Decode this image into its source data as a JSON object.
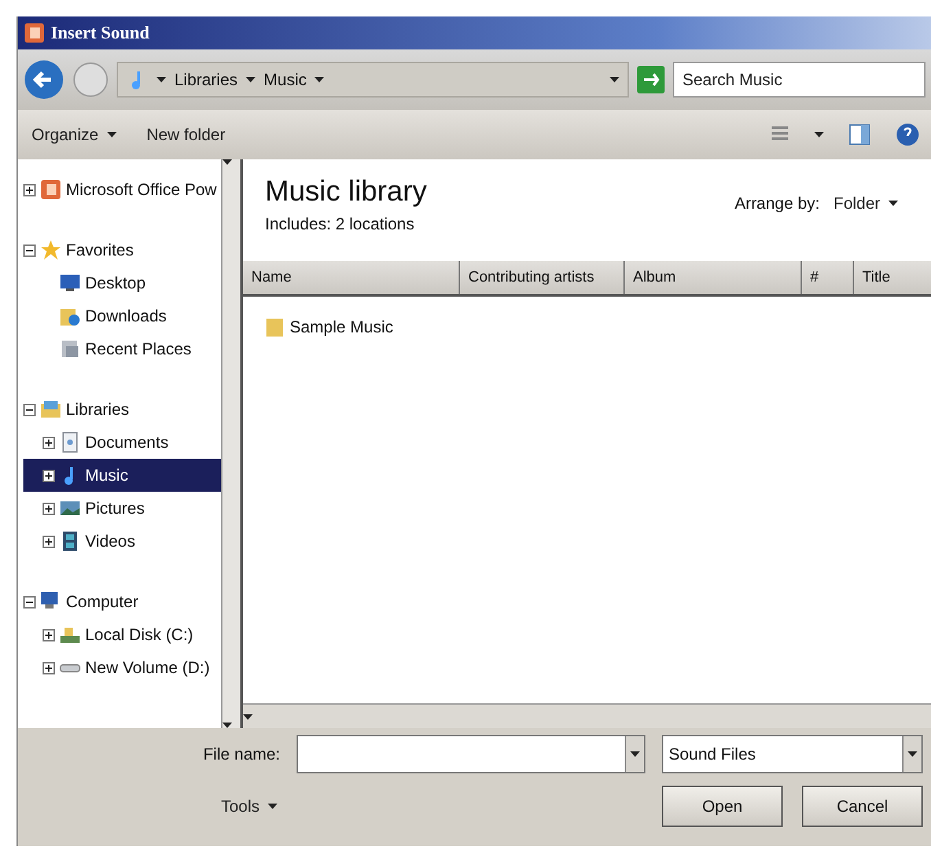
{
  "window": {
    "title": "Insert Sound"
  },
  "address": {
    "crumbs": [
      "Libraries",
      "Music"
    ]
  },
  "search": {
    "placeholder": "Search Music"
  },
  "commands": [
    {
      "label": "Organize",
      "dropdown": true
    },
    {
      "label": "New folder",
      "dropdown": false
    }
  ],
  "nav": [
    {
      "label": "Microsoft Office Pow",
      "kind": "office",
      "expanded": false,
      "selected": false
    },
    {
      "label": "Favorites",
      "kind": "star",
      "expanded": true,
      "selected": false,
      "children": [
        {
          "label": "Desktop",
          "kind": "desktop",
          "selected": false
        },
        {
          "label": "Downloads",
          "kind": "downloads",
          "selected": false
        },
        {
          "label": "Recent Places",
          "kind": "recent",
          "selected": false
        }
      ]
    },
    {
      "label": "Libraries",
      "kind": "library",
      "expanded": true,
      "selected": false,
      "children": [
        {
          "label": "Documents",
          "kind": "document",
          "expanded": false,
          "selected": false
        },
        {
          "label": "Music",
          "kind": "music",
          "expanded": false,
          "selected": true
        },
        {
          "label": "Pictures",
          "kind": "pictures",
          "expanded": false,
          "selected": false
        },
        {
          "label": "Videos",
          "kind": "video",
          "expanded": false,
          "selected": false
        }
      ]
    },
    {
      "label": "Computer",
      "kind": "computer",
      "expanded": true,
      "selected": false,
      "children": [
        {
          "label": "Local Disk (C:)",
          "kind": "disk",
          "expanded": false,
          "selected": false
        },
        {
          "label": "New Volume (D:)",
          "kind": "drive",
          "expanded": false,
          "selected": false
        }
      ]
    }
  ],
  "library": {
    "title": "Music library",
    "subtitle": "Includes: 2 locations",
    "arrange_label": "Arrange by:",
    "arrange_value": "Folder"
  },
  "table": {
    "columns": [
      "Name",
      "Contributing artists",
      "Album",
      "#",
      "Title"
    ],
    "rows": [
      {
        "name": "Sample Music"
      }
    ]
  },
  "file_name": {
    "label": "File name:"
  },
  "file_type": {
    "value": "Sound Files"
  },
  "tools": "Tools",
  "buttons": [
    "Open",
    "Cancel"
  ]
}
